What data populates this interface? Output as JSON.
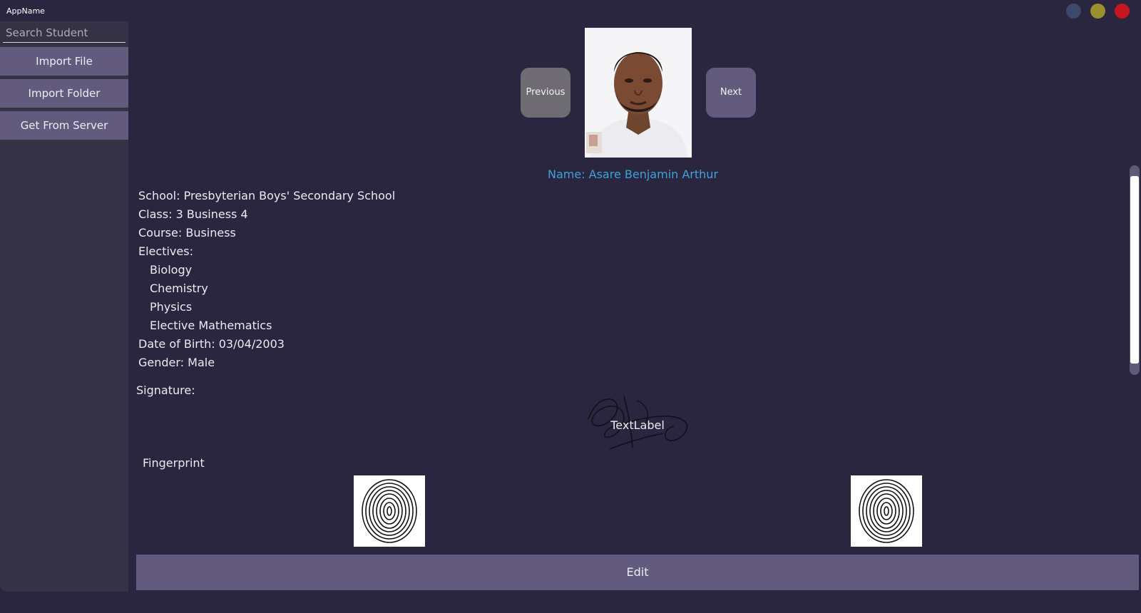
{
  "app": {
    "name": "AppName"
  },
  "window_controls": [
    {
      "name": "minimize",
      "color": "#3b4a6b"
    },
    {
      "name": "maximize",
      "color": "#9c8f2f"
    },
    {
      "name": "close",
      "color": "#c4161c"
    }
  ],
  "sidebar": {
    "search_placeholder": "Search Student",
    "buttons": [
      {
        "label": "Import File"
      },
      {
        "label": "Import Folder"
      },
      {
        "label": "Get From Server"
      }
    ]
  },
  "navigation": {
    "previous_label": "Previous",
    "next_label": "Next"
  },
  "student": {
    "name_line": "Name: Asare Benjamin Arthur",
    "school_line": "School: Presbyterian Boys' Secondary School",
    "class_line": "Class: 3 Business 4",
    "course_line": "Course: Business",
    "electives_label": "Electives:",
    "electives": [
      "Biology",
      "Chemistry",
      "Physics",
      "Elective Mathematics"
    ],
    "dob_line": "Date of Birth: 03/04/2003",
    "gender_line": "Gender: Male"
  },
  "signature": {
    "label": "Signature:",
    "placeholder_text": "TextLabel"
  },
  "fingerprint": {
    "label": "Fingerprint"
  },
  "edit_label": "Edit",
  "colors": {
    "background": "#2a2640",
    "sidebar": "#363246",
    "button": "#625b7e",
    "name_accent": "#3ea3d6",
    "previous_button": "#6e6b72"
  }
}
